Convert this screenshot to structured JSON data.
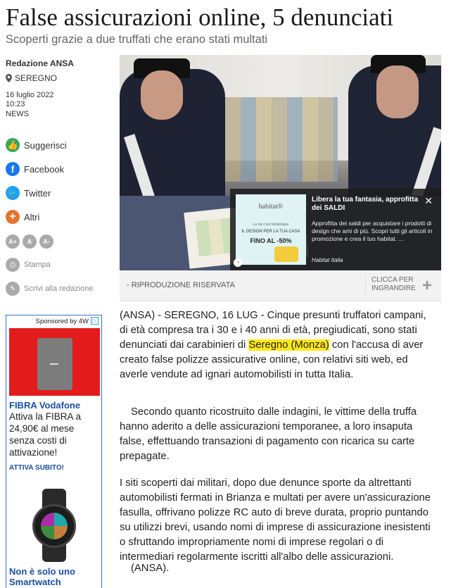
{
  "article": {
    "title": "False assicurazioni online, 5 denunciati",
    "subtitle": "Scoperti grazie a due truffati che erano stati multati",
    "author": "Redazione ANSA",
    "location": "SEREGNO",
    "date": "16 luglio 2022",
    "time": "10:23",
    "category": "NEWS",
    "caption": "- RIPRODUZIONE RISERVATA",
    "zoom_label": "CLICCA PER INGRANDIRE",
    "p1_before": "(ANSA) - SEREGNO, 16 LUG - Cinque presunti truffatori campani, di età compresa tra i 30 e i 40 anni di età, pregiudicati, sono stati denunciati dai carabinieri di ",
    "p1_highlight": "Seregno (Monza)",
    "p1_after": " con l'accusa di aver creato false polizze assicurative online, con relativi siti web, ed averle vendute ad ignari automobilisti in tutta Italia.",
    "p2": "Secondo quanto ricostruito dalle indagini, le vittime della truffa hanno aderito a delle assicurazioni temporanee, a loro insaputa false, effettuando transazioni di pagamento con ricarica su carte prepagate.",
    "p3": "I siti scoperti dai militari, dopo due denunce sporte da altrettanti automobilisti fermati in Brianza e multati per avere un'assicurazione fasulla, offrivano polizze RC auto di breve durata, proprio puntando su utilizzi brevi, usando nomi di imprese di assicurazione inesistenti o sfruttando impropriamente nomi di imprese regolari o di intermediari regolarmente iscritti all'albo delle assicurazioni.",
    "p4": "(ANSA)."
  },
  "share": {
    "suggest": "Suggerisci",
    "facebook": "Facebook",
    "twitter": "Twitter",
    "others": "Altri",
    "font_plus": "A+",
    "font_normal": "A",
    "font_minus": "A-",
    "print": "Stampa",
    "write": "Scrivi alla redazione"
  },
  "overlay_ad": {
    "title": "Libera la tua fantasia, approfitta dei SALDI",
    "body": "Approfitta dei saldi per acquistare i prodotti di design che ami di più. Scopri tutti gli articoli in promozione e crea il tuo habitat. ...",
    "brand": "Habitat Italia",
    "logo": "habitat®",
    "tagline1": "La vie c'est fantastique",
    "tagline2": "IL DESIGN PER LA TUA CASA",
    "tagline3": "FINO AL -50%",
    "close": "✕"
  },
  "side_ad": {
    "sponsor": "Sponsored by 4W",
    "heading": "FIBRA Vodafone",
    "text": "Attiva la FIBRA a 24,90€ al mese senza costi di attivazione!",
    "cta": "ATTIVA SUBITO!",
    "heading2": "Non è solo uno Smartwatch"
  },
  "colors": {
    "facebook": "#1877f2",
    "twitter": "#1da1f2",
    "suggest": "#3ba55c",
    "others": "#e8722c",
    "highlight": "#ffe817"
  }
}
